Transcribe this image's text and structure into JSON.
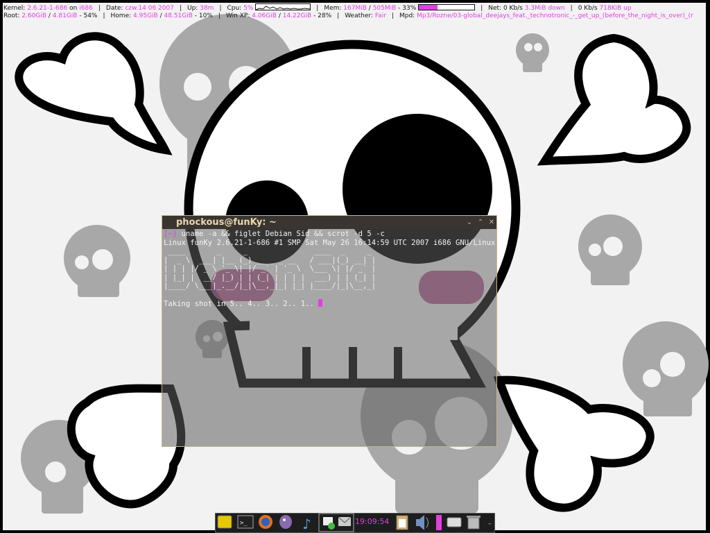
{
  "conky": {
    "kernel_label": "Kernel:",
    "kernel": "2.6.21-1-686",
    "on_label": "on",
    "arch": "i686",
    "date_label": "Date:",
    "date": "czw.14 06 2007",
    "uptime_label": "Up:",
    "uptime": "38m",
    "cpu_label": "Cpu:",
    "cpu": "5%",
    "mem_label": "Mem:",
    "mem_used": "167MiB",
    "mem_total": "505MiB",
    "mem_pct": "33%",
    "mem_fraction": 0.33,
    "net_label": "Net:",
    "net_down_rate": "0 Kb/s",
    "net_down_total": "3.3MiB down",
    "net_up_rate": "0 Kb/s",
    "net_up_total": "718KiB up",
    "root_label": "Root:",
    "root_used": "2.60GiB",
    "root_total": "4.81GiB",
    "root_pct": "54%",
    "home_label": "Home:",
    "home_used": "4.95GiB",
    "home_total": "48.51GiB",
    "home_pct": "10%",
    "winxp_label": "Win XP:",
    "winxp_used": "4.06GiB",
    "winxp_total": "14.22GiB",
    "winxp_pct": "28%",
    "weather_label": "Weather:",
    "weather": "Fair",
    "mpd_label": "Mpd:",
    "mpd": "Mp3/Rozne/03-global_deejays_feat._technotronic_-_get_up_(before_the_night_is_over)_(r"
  },
  "terminal": {
    "title": "phockous@funKy: ~",
    "prompt": "[~]",
    "command": " uname -a && figlet Debian Sid && scrot -d 5 -c",
    "uname_output": "Linux funKy 2.6.21-1-686 #1 SMP Sat May 26 16:14:59 UTC 2007 i686 GNU/Linux",
    "figlet": " ____       _     _               ____  _     _ \n|  _ \\  ___| |__ (_) __ _ _ __   / ___|(_) __| |\n| | | |/ _ \\ '_ \\| |/ _` | '_ \\  \\___ \\| |/ _` |\n| |_| |  __/ |_) | | (_| | | | |  ___) | | (_| |\n|____/ \\___|_.__/|_|\\__,_|_| |_| |____/|_|\\__,_|",
    "countdown": "Taking shot in 5.. 4.. 3.. 2.. 1.. "
  },
  "taskbar": {
    "clock": "19:09:54",
    "icons": [
      "window-icon",
      "terminal-icon",
      "firefox-icon",
      "pidgin-icon",
      "music-icon",
      "desktop-icon",
      "mail-icon",
      "clipboard-icon",
      "volume-icon",
      "drive-icon",
      "trash-icon"
    ]
  },
  "colors": {
    "accent": "#e040e0",
    "conky_text": "#111111",
    "titlebar": "#3a3530",
    "title_text": "#e8d8b0"
  }
}
